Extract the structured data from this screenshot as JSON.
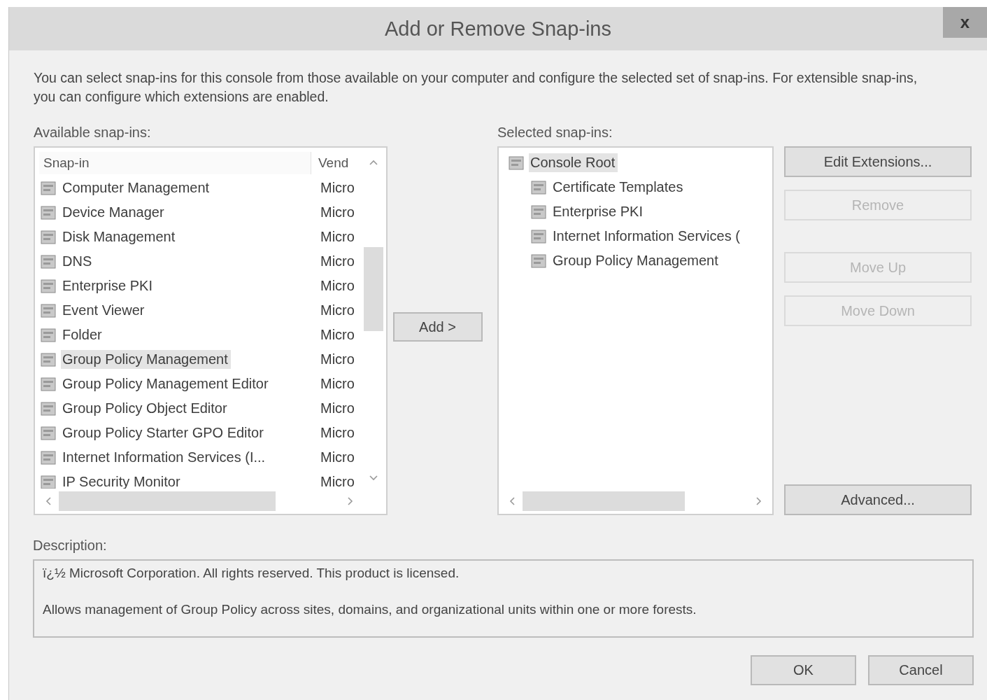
{
  "window": {
    "title": "Add or Remove Snap-ins",
    "close": "x"
  },
  "intro": "You can select snap-ins for this console from those available on your computer and configure the selected set of snap-ins. For extensible snap-ins, you can configure which extensions are enabled.",
  "available": {
    "label": "Available snap-ins:",
    "columns": [
      "Snap-in",
      "Vend"
    ],
    "rows": [
      {
        "name": "Computer Management",
        "vendor": "Micro",
        "selected": false
      },
      {
        "name": "Device Manager",
        "vendor": "Micro",
        "selected": false
      },
      {
        "name": "Disk Management",
        "vendor": "Micro",
        "selected": false
      },
      {
        "name": "DNS",
        "vendor": "Micro",
        "selected": false
      },
      {
        "name": "Enterprise PKI",
        "vendor": "Micro",
        "selected": false
      },
      {
        "name": "Event Viewer",
        "vendor": "Micro",
        "selected": false
      },
      {
        "name": "Folder",
        "vendor": "Micro",
        "selected": false
      },
      {
        "name": "Group Policy Management",
        "vendor": "Micro",
        "selected": true
      },
      {
        "name": "Group Policy Management Editor",
        "vendor": "Micro",
        "selected": false
      },
      {
        "name": "Group Policy Object Editor",
        "vendor": "Micro",
        "selected": false
      },
      {
        "name": "Group Policy Starter GPO Editor",
        "vendor": "Micro",
        "selected": false
      },
      {
        "name": "Internet Information Services (I...",
        "vendor": "Micro",
        "selected": false
      },
      {
        "name": "IP Security Monitor",
        "vendor": "Micro",
        "selected": false
      }
    ]
  },
  "add_button": "Add >",
  "selected_snapins": {
    "label": "Selected snap-ins:",
    "tree": [
      {
        "name": "Console Root",
        "selected": true,
        "children": [
          {
            "name": "Certificate Templates",
            "selected": false
          },
          {
            "name": "Enterprise PKI",
            "selected": false
          },
          {
            "name": "Internet Information Services (",
            "selected": false
          },
          {
            "name": "Group Policy Management",
            "selected": false
          }
        ]
      }
    ]
  },
  "side_buttons": [
    {
      "label": "Edit Extensions...",
      "disabled": false
    },
    {
      "label": "Remove",
      "disabled": true
    },
    {
      "label": "Move Up",
      "disabled": true
    },
    {
      "label": "Move Down",
      "disabled": true
    }
  ],
  "advanced_button": {
    "label": "Advanced...",
    "disabled": false
  },
  "description": {
    "label": "Description:",
    "lines": [
      "ï¿½ Microsoft Corporation. All rights reserved. This product is licensed.",
      "Allows management of Group Policy across sites, domains, and organizational units within one or more forests."
    ]
  },
  "footer_buttons": [
    "OK",
    "Cancel"
  ]
}
